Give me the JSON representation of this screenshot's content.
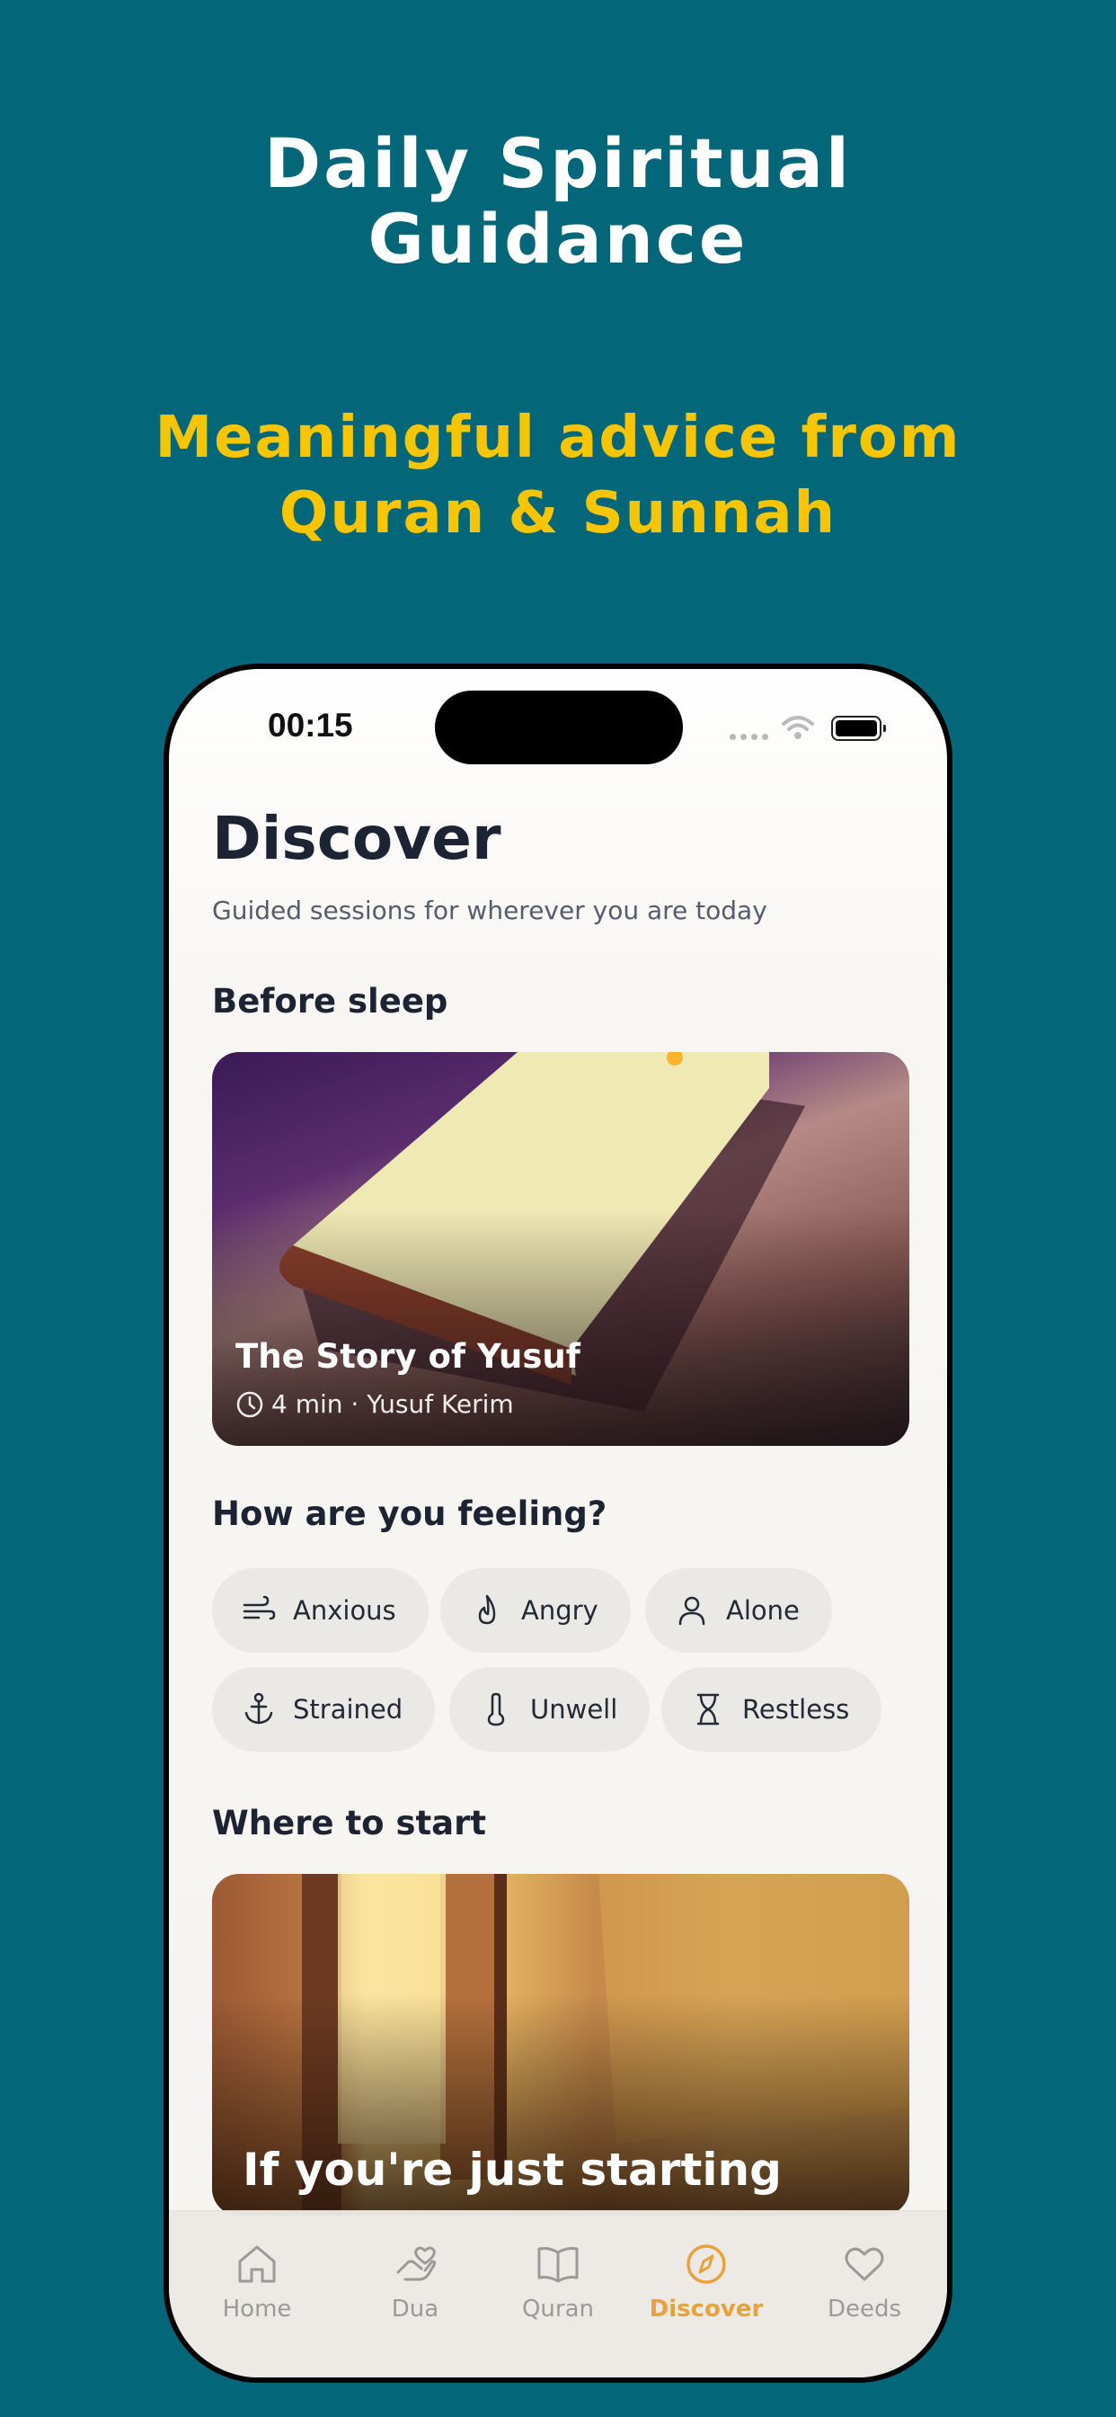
{
  "promo": {
    "title_line1": "Daily Spiritual",
    "title_line2": "Guidance",
    "subtitle_line1": "Meaningful advice from",
    "subtitle_line2": "Quran & Sunnah"
  },
  "status_bar": {
    "time": "00:15"
  },
  "page": {
    "title": "Discover",
    "subtitle": "Guided sessions for wherever you are today"
  },
  "sections": {
    "before_sleep": "Before sleep",
    "feeling": "How are you feeling?",
    "where_to_start": "Where to start"
  },
  "featured_card": {
    "title": "The Story of Yusuf",
    "meta": "4 min · Yusuf Kerim",
    "meta_icon": "clock-icon"
  },
  "feelings": [
    {
      "label": "Anxious",
      "icon": "wind-icon"
    },
    {
      "label": "Angry",
      "icon": "flame-icon"
    },
    {
      "label": "Alone",
      "icon": "person-icon"
    },
    {
      "label": "Strained",
      "icon": "anchor-icon"
    },
    {
      "label": "Unwell",
      "icon": "thermometer-icon"
    },
    {
      "label": "Restless",
      "icon": "hourglass-icon"
    }
  ],
  "start_card": {
    "title": "If you're just starting"
  },
  "tabs": [
    {
      "label": "Home",
      "icon": "home-icon"
    },
    {
      "label": "Dua",
      "icon": "hands-icon"
    },
    {
      "label": "Quran",
      "icon": "book-icon"
    },
    {
      "label": "Discover",
      "icon": "compass-icon",
      "active": true
    },
    {
      "label": "Deeds",
      "icon": "heart-icon"
    }
  ],
  "colors": {
    "background": "#036779",
    "promo_subtitle": "#f8c600",
    "active_tab": "#e9a23a"
  }
}
